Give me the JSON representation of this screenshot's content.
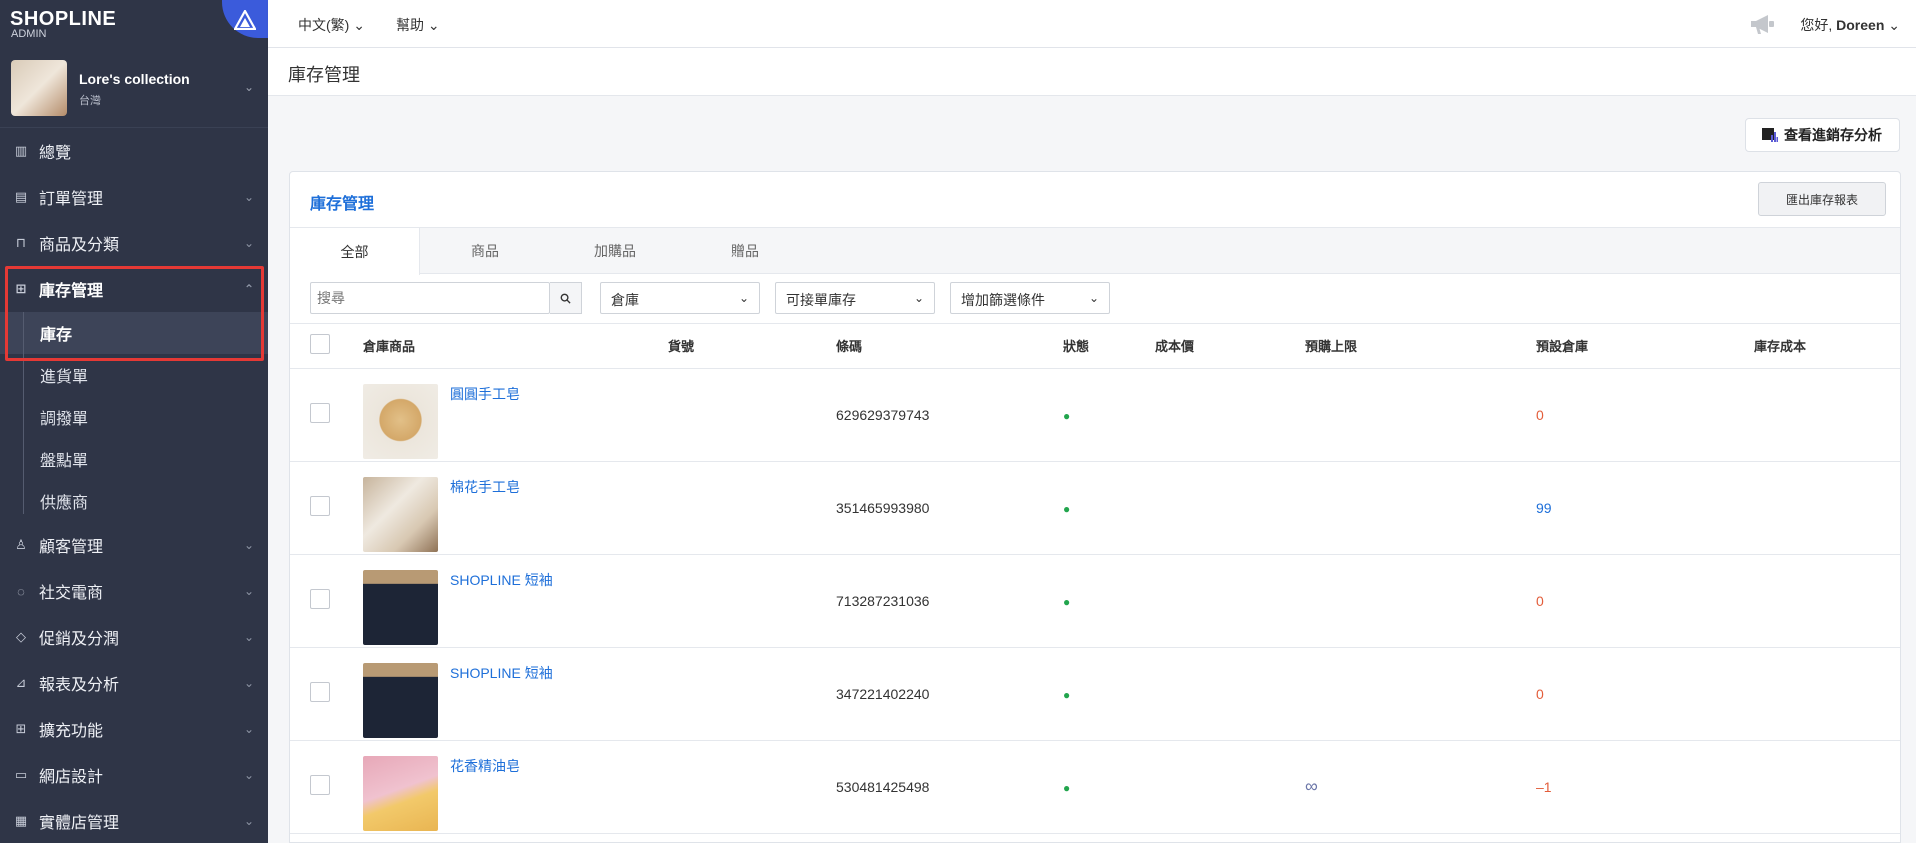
{
  "brand": {
    "logo": "SHOPLINE",
    "sub": "ADMIN"
  },
  "store": {
    "name": "Lore's collection",
    "region": "台灣"
  },
  "nav": {
    "overview": "總覽",
    "orders": "訂單管理",
    "products": "商品及分類",
    "inventory": "庫存管理",
    "inventory_sub": [
      "庫存",
      "進貨單",
      "調撥單",
      "盤點單",
      "供應商"
    ],
    "customers": "顧客管理",
    "social": "社交電商",
    "promotions": "促銷及分潤",
    "reports": "報表及分析",
    "apps": "擴充功能",
    "design": "網店設計",
    "retail": "實體店管理"
  },
  "topbar": {
    "lang": "中文(繁)",
    "help": "幫助",
    "greeting": "您好,",
    "user": "Doreen"
  },
  "page": {
    "title": "庫存管理",
    "analysis_btn": "查看進銷存分析"
  },
  "card": {
    "title": "庫存管理",
    "export_btn": "匯出庫存報表",
    "tabs": [
      "全部",
      "商品",
      "加購品",
      "贈品"
    ],
    "search_placeholder": "搜尋",
    "filters": [
      "倉庫",
      "可接單庫存",
      "增加篩選條件"
    ]
  },
  "table": {
    "headers": [
      "倉庫商品",
      "貨號",
      "條碼",
      "狀態",
      "成本價",
      "預購上限",
      "預設倉庫",
      "庫存成本"
    ],
    "rows": [
      {
        "name": "圓圓手工皂",
        "barcode": "629629379743",
        "preorder": "",
        "stock": "0",
        "stock_color": "#e35d3a"
      },
      {
        "name": "棉花手工皂",
        "barcode": "351465993980",
        "preorder": "",
        "stock": "99",
        "stock_color": "#1e6fd9"
      },
      {
        "name": "SHOPLINE 短袖",
        "barcode": "713287231036",
        "preorder": "",
        "stock": "0",
        "stock_color": "#e35d3a"
      },
      {
        "name": "SHOPLINE 短袖",
        "barcode": "347221402240",
        "preorder": "",
        "stock": "0",
        "stock_color": "#e35d3a"
      },
      {
        "name": "花香精油皂",
        "barcode": "530481425498",
        "preorder": "∞",
        "stock": "–1",
        "stock_color": "#e35d3a"
      }
    ]
  },
  "colors": {
    "sidebar_bg": "#2f3547",
    "accent_blue": "#1e6fd9",
    "highlight_red": "#e53935",
    "status_green": "#22a54d"
  }
}
